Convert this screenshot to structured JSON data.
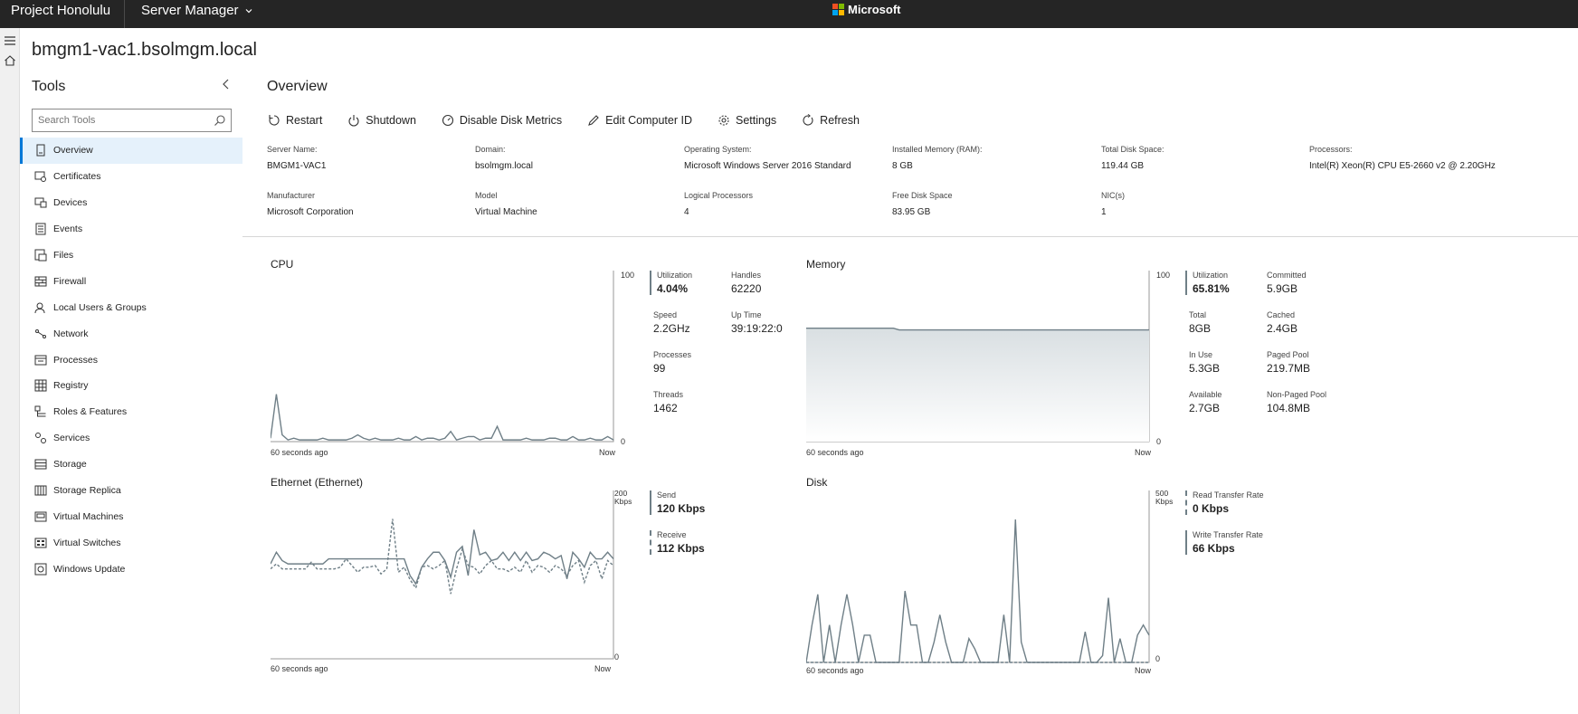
{
  "topbar": {
    "brand": "Project Honolulu",
    "app": "Server Manager",
    "company": "Microsoft"
  },
  "server": {
    "name": "bmgm1-vac1.bsolmgm.local"
  },
  "tools": {
    "title": "Tools",
    "search_placeholder": "Search Tools",
    "items": [
      {
        "label": "Overview",
        "icon": "overview-icon"
      },
      {
        "label": "Certificates",
        "icon": "certificates-icon"
      },
      {
        "label": "Devices",
        "icon": "devices-icon"
      },
      {
        "label": "Events",
        "icon": "events-icon"
      },
      {
        "label": "Files",
        "icon": "files-icon"
      },
      {
        "label": "Firewall",
        "icon": "firewall-icon"
      },
      {
        "label": "Local Users & Groups",
        "icon": "users-icon"
      },
      {
        "label": "Network",
        "icon": "network-icon"
      },
      {
        "label": "Processes",
        "icon": "processes-icon"
      },
      {
        "label": "Registry",
        "icon": "registry-icon"
      },
      {
        "label": "Roles & Features",
        "icon": "roles-icon"
      },
      {
        "label": "Services",
        "icon": "services-icon"
      },
      {
        "label": "Storage",
        "icon": "storage-icon"
      },
      {
        "label": "Storage Replica",
        "icon": "storage-replica-icon"
      },
      {
        "label": "Virtual Machines",
        "icon": "virtual-machines-icon"
      },
      {
        "label": "Virtual Switches",
        "icon": "virtual-switches-icon"
      },
      {
        "label": "Windows Update",
        "icon": "windows-update-icon"
      }
    ]
  },
  "overview": {
    "title": "Overview",
    "toolbar": {
      "restart": "Restart",
      "shutdown": "Shutdown",
      "disable_disk_metrics": "Disable Disk Metrics",
      "edit_computer_id": "Edit Computer ID",
      "settings": "Settings",
      "refresh": "Refresh"
    },
    "properties": {
      "server_name": {
        "k": "Server Name:",
        "v": "BMGM1-VAC1"
      },
      "domain": {
        "k": "Domain:",
        "v": "bsolmgm.local"
      },
      "os": {
        "k": "Operating System:",
        "v": "Microsoft Windows Server 2016 Standard"
      },
      "memory": {
        "k": "Installed Memory (RAM):",
        "v": "8 GB"
      },
      "disk_total": {
        "k": "Total Disk Space:",
        "v": "119.44 GB"
      },
      "processors": {
        "k": "Processors:",
        "v": "Intel(R) Xeon(R) CPU E5-2660 v2 @ 2.20GHz"
      },
      "manufacturer": {
        "k": "Manufacturer",
        "v": "Microsoft Corporation"
      },
      "model": {
        "k": "Model",
        "v": "Virtual Machine"
      },
      "logical_processors": {
        "k": "Logical Processors",
        "v": "4"
      },
      "free_disk": {
        "k": "Free Disk Space",
        "v": "83.95 GB"
      },
      "nics": {
        "k": "NIC(s)",
        "v": "1"
      }
    }
  },
  "cpu": {
    "title": "CPU",
    "y_max": "100",
    "y_min": "0",
    "x_start": "60 seconds ago",
    "x_end": "Now",
    "stats": {
      "utilization": {
        "k": "Utilization",
        "v": "4.04%"
      },
      "handles": {
        "k": "Handles",
        "v": "62220"
      },
      "speed": {
        "k": "Speed",
        "v": "2.2GHz"
      },
      "uptime": {
        "k": "Up Time",
        "v": "39:19:22:0"
      },
      "processes": {
        "k": "Processes",
        "v": "99"
      },
      "threads": {
        "k": "Threads",
        "v": "1462"
      }
    }
  },
  "memory": {
    "title": "Memory",
    "y_max": "100",
    "y_min": "0",
    "x_start": "60 seconds ago",
    "x_end": "Now",
    "stats": {
      "utilization": {
        "k": "Utilization",
        "v": "65.81%"
      },
      "committed": {
        "k": "Committed",
        "v": "5.9GB"
      },
      "total": {
        "k": "Total",
        "v": "8GB"
      },
      "cached": {
        "k": "Cached",
        "v": "2.4GB"
      },
      "in_use": {
        "k": "In Use",
        "v": "5.3GB"
      },
      "paged_pool": {
        "k": "Paged Pool",
        "v": "219.7MB"
      },
      "available": {
        "k": "Available",
        "v": "2.7GB"
      },
      "non_paged_pool": {
        "k": "Non-Paged Pool",
        "v": "104.8MB"
      }
    }
  },
  "ethernet": {
    "title": "Ethernet (Ethernet)",
    "y_max": "200",
    "y_unit": "Kbps",
    "y_min": "0",
    "x_start": "60 seconds ago",
    "x_end": "Now",
    "stats": {
      "send": {
        "k": "Send",
        "v": "120 Kbps"
      },
      "receive": {
        "k": "Receive",
        "v": "112 Kbps"
      }
    }
  },
  "disk": {
    "title": "Disk",
    "y_max": "500",
    "y_unit": "Kbps",
    "y_min": "0",
    "x_start": "60 seconds ago",
    "x_end": "Now",
    "stats": {
      "read": {
        "k": "Read Transfer Rate",
        "v": "0 Kbps"
      },
      "write": {
        "k": "Write Transfer Rate",
        "v": "66 Kbps"
      }
    }
  },
  "chart_data": [
    {
      "type": "line",
      "name": "cpu",
      "ylim": [
        0,
        100
      ],
      "series": [
        {
          "values": [
            2,
            28,
            4,
            1,
            2,
            1,
            1,
            1,
            1,
            2,
            1,
            1,
            1,
            1,
            2,
            4,
            2,
            1,
            2,
            1,
            1,
            1,
            2,
            1,
            1,
            3,
            1,
            2,
            2,
            1,
            2,
            6,
            1,
            2,
            3,
            3,
            1,
            2,
            2,
            9,
            1,
            1,
            1,
            1,
            2,
            1,
            1,
            1,
            2,
            2,
            1,
            1,
            3,
            1,
            1,
            2,
            1,
            1,
            3,
            1
          ]
        }
      ]
    },
    {
      "type": "area",
      "name": "memory",
      "ylim": [
        0,
        100
      ],
      "series": [
        {
          "values": [
            67,
            67,
            67,
            67,
            67,
            67,
            67,
            67,
            67,
            67,
            67,
            67,
            67,
            67,
            67,
            67,
            66,
            66,
            66,
            66,
            66,
            66,
            66,
            66,
            66,
            66,
            66,
            66,
            66,
            66,
            66,
            66,
            66,
            66,
            66,
            66,
            66,
            66,
            66,
            66,
            66,
            66,
            66,
            66,
            66,
            66,
            66,
            66,
            66,
            66,
            66,
            66,
            66,
            66,
            66,
            66,
            66,
            66,
            66,
            66
          ]
        }
      ]
    },
    {
      "type": "line",
      "name": "ethernet",
      "ylim": [
        0,
        200
      ],
      "series": [
        {
          "style": "solid",
          "values": [
            114,
            128,
            118,
            114,
            114,
            114,
            114,
            114,
            114,
            114,
            120,
            120,
            120,
            120,
            120,
            120,
            120,
            120,
            120,
            120,
            120,
            120,
            120,
            120,
            100,
            90,
            110,
            120,
            128,
            128,
            118,
            98,
            128,
            135,
            100,
            155,
            125,
            128,
            118,
            120,
            128,
            118,
            128,
            118,
            128,
            118,
            120,
            128,
            125,
            120,
            124,
            96,
            128,
            120,
            110,
            128,
            120,
            120,
            128,
            120
          ]
        },
        {
          "style": "dashed",
          "values": [
            108,
            114,
            108,
            108,
            108,
            108,
            108,
            116,
            108,
            108,
            108,
            108,
            110,
            120,
            112,
            104,
            110,
            110,
            112,
            102,
            108,
            168,
            104,
            110,
            95,
            85,
            110,
            112,
            108,
            112,
            118,
            78,
            108,
            132,
            112,
            110,
            102,
            112,
            118,
            108,
            108,
            105,
            110,
            104,
            118,
            104,
            112,
            110,
            104,
            112,
            108,
            100,
            112,
            118,
            92,
            112,
            118,
            96,
            118,
            112
          ]
        }
      ]
    },
    {
      "type": "line",
      "name": "disk",
      "ylim": [
        0,
        500
      ],
      "series": [
        {
          "style": "solid",
          "values": [
            0,
            110,
            200,
            0,
            110,
            0,
            110,
            200,
            110,
            0,
            80,
            80,
            0,
            0,
            0,
            0,
            0,
            210,
            110,
            110,
            0,
            0,
            60,
            140,
            60,
            0,
            0,
            0,
            70,
            40,
            0,
            0,
            0,
            0,
            140,
            0,
            420,
            60,
            0,
            0,
            0,
            0,
            0,
            0,
            0,
            0,
            0,
            0,
            90,
            0,
            0,
            20,
            190,
            0,
            70,
            0,
            0,
            80,
            110,
            80
          ]
        },
        {
          "style": "dashed",
          "values": [
            0,
            0,
            0,
            0,
            0,
            0,
            0,
            0,
            0,
            0,
            0,
            0,
            0,
            0,
            0,
            0,
            0,
            0,
            0,
            0,
            0,
            0,
            0,
            0,
            0,
            0,
            0,
            0,
            0,
            0,
            0,
            0,
            0,
            0,
            0,
            0,
            0,
            0,
            0,
            0,
            0,
            0,
            0,
            0,
            0,
            0,
            0,
            0,
            0,
            0,
            0,
            0,
            0,
            0,
            0,
            0,
            0,
            0,
            0,
            0
          ]
        }
      ]
    }
  ],
  "colors": {
    "topbar": "#252525",
    "accent": "#0078d7",
    "line": "#6f7f87",
    "active_bg": "#e5f1fb"
  }
}
